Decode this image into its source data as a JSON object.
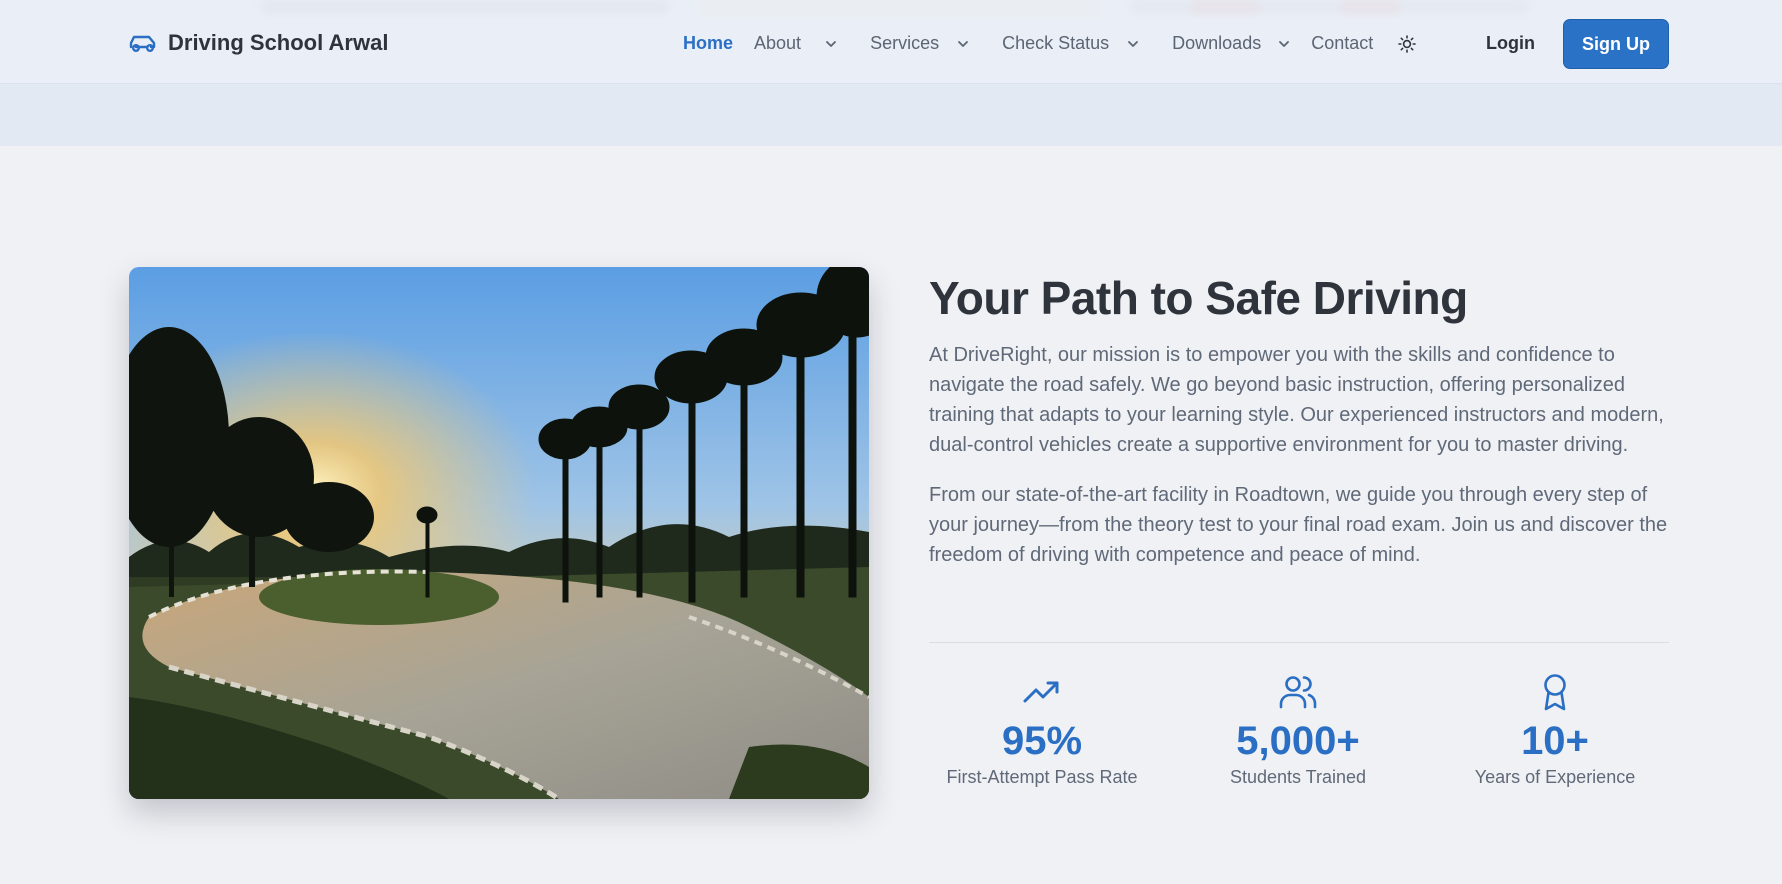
{
  "header": {
    "brand": "Driving School Arwal",
    "nav": [
      {
        "label": "Home",
        "active": true,
        "dropdown": false
      },
      {
        "label": "About",
        "active": false,
        "dropdown": true
      },
      {
        "label": "Services",
        "active": false,
        "dropdown": true
      },
      {
        "label": "Check Status",
        "active": false,
        "dropdown": true
      },
      {
        "label": "Downloads",
        "active": false,
        "dropdown": true
      },
      {
        "label": "Contact",
        "active": false,
        "dropdown": false
      }
    ],
    "theme_icon": "sun-icon",
    "login_label": "Login",
    "signup_label": "Sign Up"
  },
  "main": {
    "title": "Your Path to Safe Driving",
    "paragraph1": "At DriveRight, our mission is to empower you with the skills and confidence to navigate the road safely. We go beyond basic instruction, offering personalized training that adapts to your learning style. Our experienced instructors and modern, dual-control vehicles create a supportive environment for you to master driving.",
    "paragraph2": "From our state-of-the-art facility in Roadtown, we guide you through every step of your journey—from the theory test to your final road exam. Join us and discover the freedom of driving with competence and peace of mind.",
    "stats": [
      {
        "icon": "trending-up-icon",
        "value": "95%",
        "label": "First-Attempt Pass Rate"
      },
      {
        "icon": "users-icon",
        "value": "5,000+",
        "label": "Students Trained"
      },
      {
        "icon": "award-icon",
        "value": "10+",
        "label": "Years of Experience"
      }
    ]
  },
  "colors": {
    "accent": "#2a6fc4",
    "button": "#2a72c6",
    "background": "#f0f1f5"
  }
}
